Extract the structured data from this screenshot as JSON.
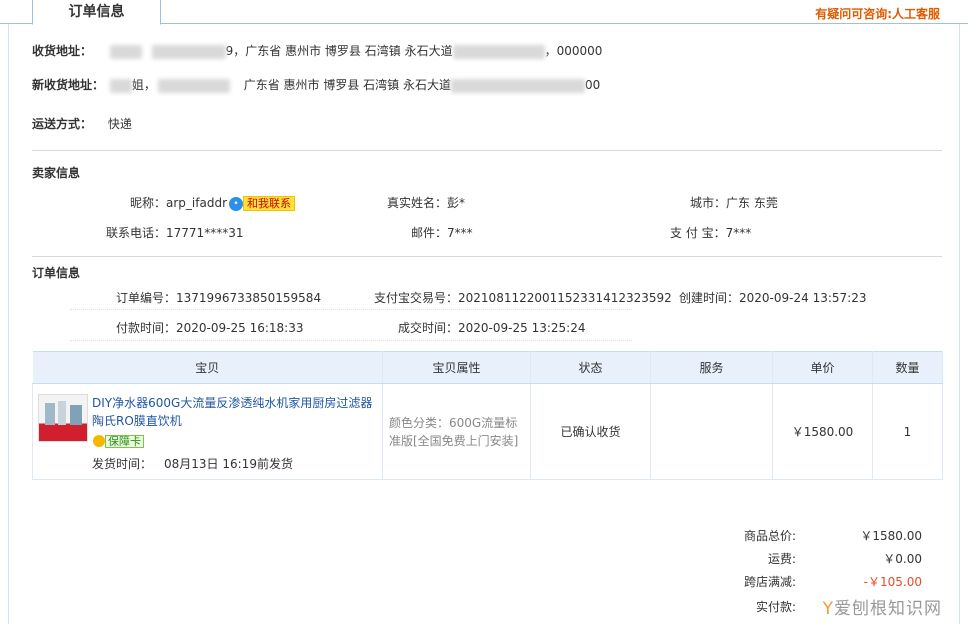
{
  "tab_title": "订单信息",
  "help_text": "有疑问可咨询:人工客服",
  "address": {
    "label": "收货地址：",
    "visible_mid": "9，广东省 惠州市 博罗县 石湾镇 永石大道",
    "visible_tail": "，000000"
  },
  "new_address": {
    "label": "新收货地址：",
    "visible_a": "姐，",
    "visible_b": "广东省 惠州市 博罗县 石湾镇 永石大道",
    "visible_tail": "00"
  },
  "shipping": {
    "label": "运送方式：",
    "value": "快递"
  },
  "seller": {
    "title": "卖家信息",
    "nick_label": "昵称：",
    "nick": "arp_ifaddr",
    "contact_label": "和我联系",
    "real_name_label": "真实姓名：",
    "real_name": "彭*",
    "city_label": "城市：",
    "city": "广东 东莞",
    "phone_label": "联系电话：",
    "phone": "17771****31",
    "email_label": "邮件：",
    "email": "7***",
    "alipay_label": "支 付 宝：",
    "alipay": "7***"
  },
  "order": {
    "title": "订单信息",
    "no_label": "订单编号：",
    "no": "1371996733850159584",
    "alipay_no_label": "支付宝交易号：",
    "alipay_no": "2021081122001152331412323592",
    "created_label": "创建时间：",
    "created": "2020-09-24 13:57:23",
    "paid_label": "付款时间：",
    "paid": "2020-09-25 16:18:33",
    "deal_label": "成交时间：",
    "deal": "2020-09-25 13:25:24"
  },
  "table": {
    "headers": [
      "宝贝",
      "宝贝属性",
      "状态",
      "服务",
      "单价",
      "数量"
    ],
    "item": {
      "title": "DIY净水器600G大流量反渗透纯水机家用厨房过滤器陶氏RO膜直饮机",
      "badge": "保障卡",
      "ship_label": "发货时间：",
      "ship_time": "08月13日 16:19前发货",
      "attr": "颜色分类：600G流量标准版[全国免费上门安装]",
      "status": "已确认收货",
      "service": "",
      "price": "￥1580.00",
      "qty": "1"
    }
  },
  "summary": {
    "total_label": "商品总价:",
    "total": "￥1580.00",
    "freight_label": "运费:",
    "freight": "￥0.00",
    "discount_label": "跨店满减:",
    "discount": "-￥105.00",
    "paid_label": "实付款:"
  },
  "watermark": {
    "symbol": "Y",
    "text": "爱刨根知识网"
  }
}
